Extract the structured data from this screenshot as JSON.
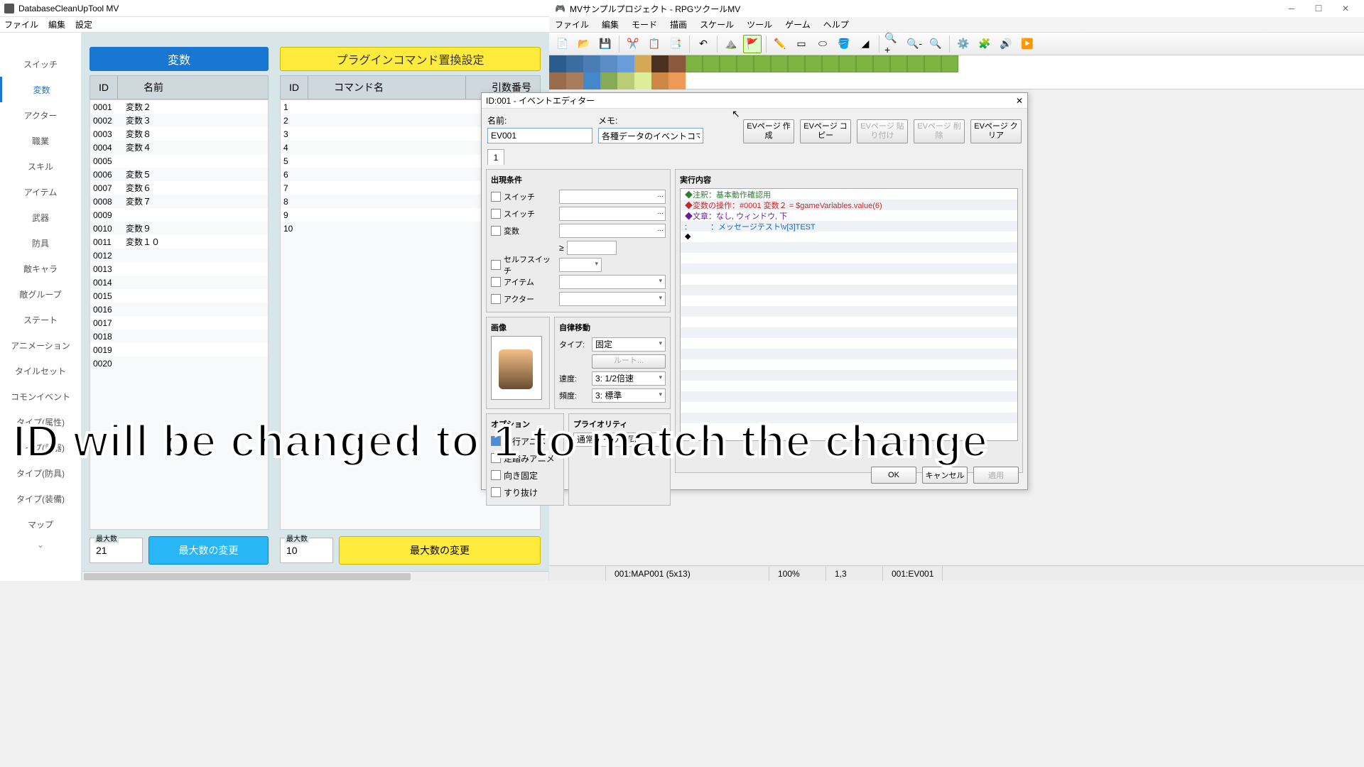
{
  "left": {
    "title": "DatabaseCleanUpTool MV",
    "menu": [
      "ファイル",
      "編集",
      "設定"
    ],
    "sidebar": [
      "スイッチ",
      "変数",
      "アクター",
      "職業",
      "スキル",
      "アイテム",
      "武器",
      "防具",
      "敵キャラ",
      "敵グループ",
      "ステート",
      "アニメーション",
      "タイルセット",
      "コモンイベント",
      "タイプ(属性)",
      "タイプ(武器)",
      "タイプ(防具)",
      "タイプ(装備)",
      "マップ"
    ],
    "sidebar_active": 1,
    "panelA": {
      "header": "変数",
      "col_id": "ID",
      "col_name": "名前",
      "rows": [
        {
          "id": "0001",
          "name": "変数２"
        },
        {
          "id": "0002",
          "name": "変数３"
        },
        {
          "id": "0003",
          "name": "変数８"
        },
        {
          "id": "0004",
          "name": "変数４"
        },
        {
          "id": "0005",
          "name": ""
        },
        {
          "id": "0006",
          "name": "変数５"
        },
        {
          "id": "0007",
          "name": "変数６"
        },
        {
          "id": "0008",
          "name": "変数７"
        },
        {
          "id": "0009",
          "name": ""
        },
        {
          "id": "0010",
          "name": "変数９"
        },
        {
          "id": "0011",
          "name": "変数１０"
        },
        {
          "id": "0012",
          "name": ""
        },
        {
          "id": "0013",
          "name": ""
        },
        {
          "id": "0014",
          "name": ""
        },
        {
          "id": "0015",
          "name": ""
        },
        {
          "id": "0016",
          "name": ""
        },
        {
          "id": "0017",
          "name": ""
        },
        {
          "id": "0018",
          "name": ""
        },
        {
          "id": "0019",
          "name": ""
        },
        {
          "id": "0020",
          "name": ""
        }
      ],
      "max_label": "最大数",
      "max_value": "21",
      "change_btn": "最大数の変更"
    },
    "panelB": {
      "header": "プラグインコマンド置換設定",
      "col_id": "ID",
      "col_name": "コマンド名",
      "col_arg": "引数番号",
      "rows": [
        "1",
        "2",
        "3",
        "4",
        "5",
        "6",
        "7",
        "8",
        "9",
        "10"
      ],
      "max_label": "最大数",
      "max_value": "10",
      "change_btn": "最大数の変更"
    }
  },
  "right": {
    "title": "MVサンプルプロジェクト - RPGツクールMV",
    "menu": [
      "ファイル",
      "編集",
      "モード",
      "描画",
      "スケール",
      "ツール",
      "ゲーム",
      "ヘルプ"
    ],
    "status": {
      "map": "001:MAP001 (5x13)",
      "zoom": "100%",
      "coord": "1,3",
      "event": "001:EV001"
    }
  },
  "evt": {
    "title": "ID:001 - イベントエディター",
    "name_label": "名前:",
    "name_value": "EV001",
    "memo_label": "メモ:",
    "memo_value": "各種データのイベントコマン",
    "btns": [
      "EVページ\n作成",
      "EVページ\nコピー",
      "EVページ\n貼り付け",
      "EVページ\n削除",
      "EVページ\nクリア"
    ],
    "tab": "1",
    "cond_title": "出現条件",
    "cond": {
      "sw1": "スイッチ",
      "sw2": "スイッチ",
      "var": "変数",
      "self": "セルフスイッチ",
      "item": "アイテム",
      "actor": "アクター",
      "ge": "≥"
    },
    "img_title": "画像",
    "auto_title": "自律移動",
    "auto": {
      "type_l": "タイプ:",
      "type_v": "固定",
      "route": "ルート...",
      "speed_l": "速度:",
      "speed_v": "3: 1/2倍速",
      "freq_l": "頻度:",
      "freq_v": "3: 標準"
    },
    "opt_title": "オプション",
    "opts": [
      "歩行アニメ",
      "足踏みアニメ",
      "向き固定",
      "すり抜け"
    ],
    "pri_title": "プライオリティ",
    "pri_v": "通常キャラと同じ",
    "exec_title": "実行内容",
    "exec": [
      {
        "cls": "green",
        "t": "◆注釈：基本動作確認用"
      },
      {
        "cls": "red",
        "t": "◆変数の操作：#0001 変数２ = $gameVariables.value(6)"
      },
      {
        "cls": "mag",
        "t": "◆文章：なし, ウィンドウ, 下"
      },
      {
        "cls": "blue",
        "t": " :　　　：メッセージテスト\\v[3]TEST"
      },
      {
        "cls": "dia",
        "t": "◆"
      }
    ],
    "foot": {
      "ok": "OK",
      "cancel": "キャンセル",
      "apply": "適用"
    }
  },
  "overlay": "ID will be changed to 1 to match the change"
}
